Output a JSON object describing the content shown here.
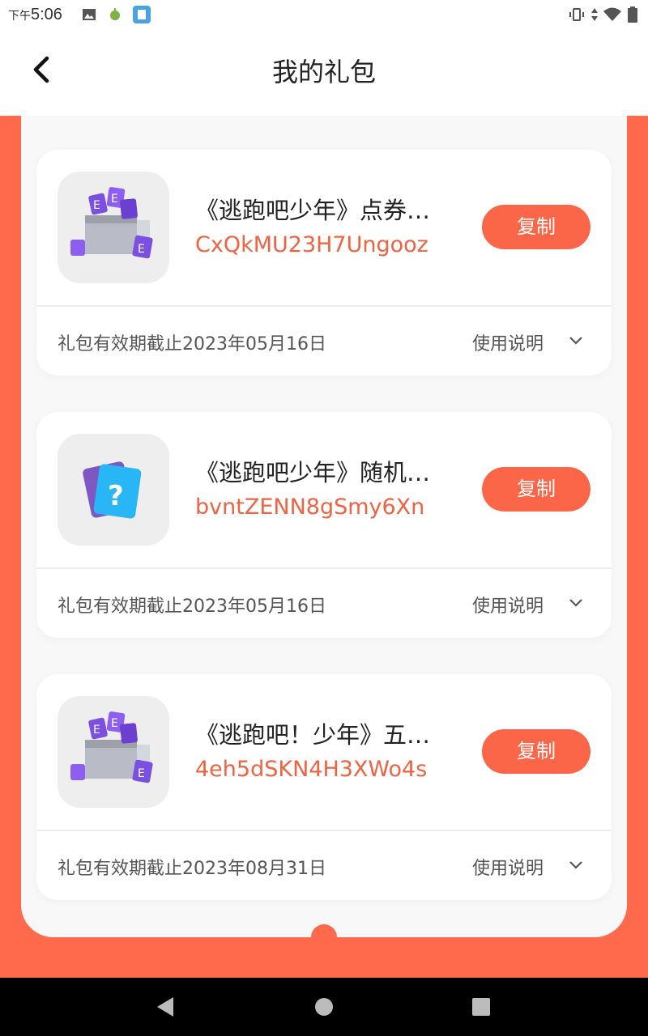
{
  "status_bar": {
    "time_prefix": "下午",
    "time": "5:06"
  },
  "header": {
    "title": "我的礼包"
  },
  "gifts": [
    {
      "name": "《逃跑吧少年》点券…",
      "code": "CxQkMU23H7Ungooz",
      "copy_label": "复制",
      "expiry": "礼包有效期截止2023年05月16日",
      "usage_label": "使用说明",
      "icon": "coupon-box-icon"
    },
    {
      "name": "《逃跑吧少年》随机…",
      "code": "bvntZENN8gSmy6Xn",
      "copy_label": "复制",
      "expiry": "礼包有效期截止2023年05月16日",
      "usage_label": "使用说明",
      "icon": "mystery-card-icon"
    },
    {
      "name": "《逃跑吧！少年》五…",
      "code": "4eh5dSKN4H3XWo4s",
      "copy_label": "复制",
      "expiry": "礼包有效期截止2023年08月31日",
      "usage_label": "使用说明",
      "icon": "coupon-box-icon"
    }
  ],
  "colors": {
    "accent": "#fb6548",
    "code_text": "#f06342",
    "background": "#ff6a4d"
  }
}
